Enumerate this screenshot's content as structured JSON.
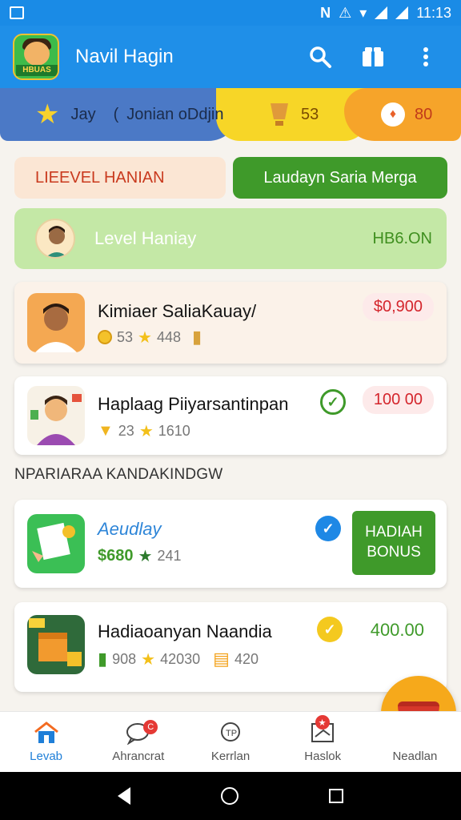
{
  "status_bar": {
    "time": "11:13"
  },
  "app_bar": {
    "title": "Navil Hagin",
    "logo_text": "HBUAS"
  },
  "stats": {
    "label_a": "Jay",
    "label_b": "Jonian oDdjin",
    "coins": "53",
    "gems": "80"
  },
  "pills": {
    "left": "LIEEVEL HANIAN",
    "right": "Laudayn Saria Merga"
  },
  "level_card": {
    "title": "Level Haniay",
    "value": "HB6.ON"
  },
  "cards": [
    {
      "name": "Kimiaer SaliaKauay/",
      "sub_a": "53",
      "sub_b": "448",
      "amount": "$0,900"
    },
    {
      "name": "Haplaag Piiyarsantinpan",
      "sub_a": "23",
      "sub_b": "1610",
      "amount": "100 00"
    }
  ],
  "section": {
    "label": "NPARIARAA KANDAKINDGW"
  },
  "cards2": [
    {
      "name": "Aeudlay",
      "price": "$680",
      "sub_b": "241",
      "button_line1": "HADIAH",
      "button_line2": "BONUS"
    },
    {
      "name": "Hadiaoanyan Naandia",
      "sub_a": "908",
      "sub_b": "42030",
      "sub_c": "420",
      "amount": "400.00"
    }
  ],
  "bottom_nav": [
    {
      "label": "Levab"
    },
    {
      "label": "Ahrancrat"
    },
    {
      "label": "Kerrlan"
    },
    {
      "label": "Haslok"
    },
    {
      "label": "Neadlan"
    }
  ],
  "colors": {
    "app_bar": "#1f8fe8",
    "green_button": "#3f9a2a",
    "price_red": "#d4252c",
    "level_green": "#c4e8a6"
  }
}
